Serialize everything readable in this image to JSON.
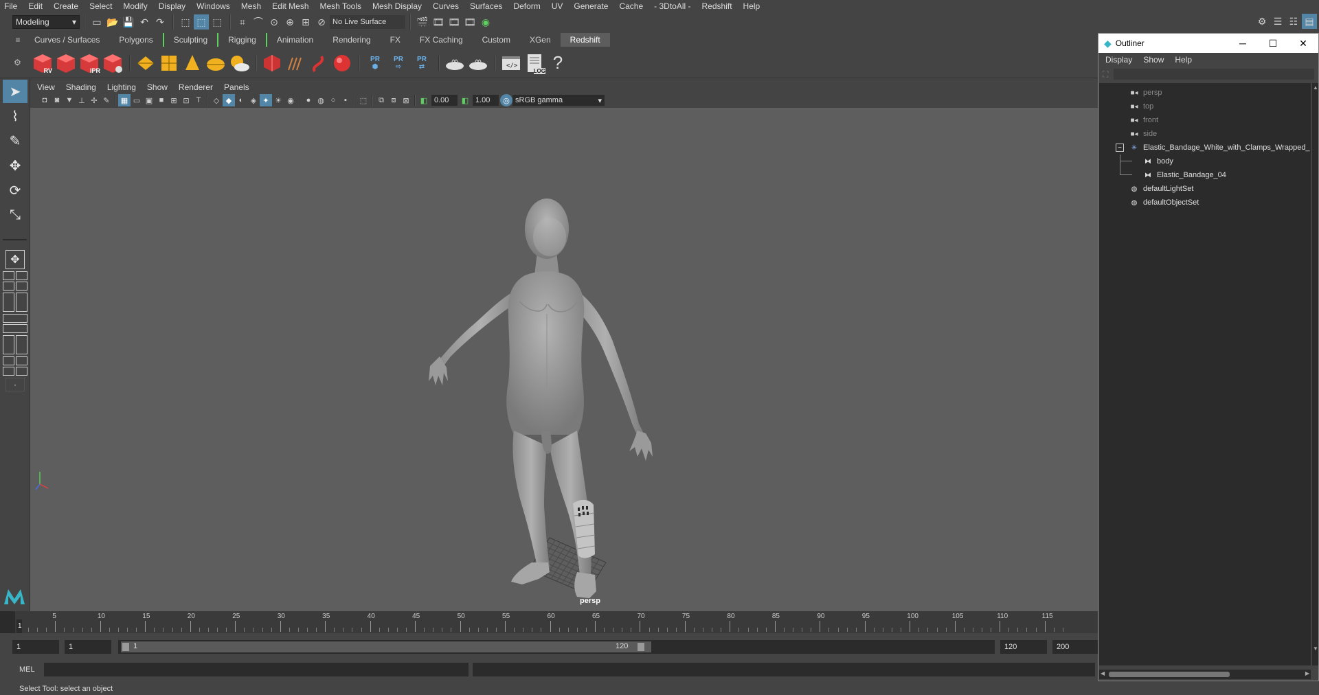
{
  "menubar": {
    "items": [
      "File",
      "Edit",
      "Create",
      "Select",
      "Modify",
      "Display",
      "Windows",
      "Mesh",
      "Edit Mesh",
      "Mesh Tools",
      "Mesh Display",
      "Curves",
      "Surfaces",
      "Deform",
      "UV",
      "Generate",
      "Cache",
      "- 3DtoAll -",
      "Redshift",
      "Help"
    ]
  },
  "statusline": {
    "mode": "Modeling",
    "live_surface": "No Live Surface"
  },
  "shelf": {
    "tabs": [
      "Curves / Surfaces",
      "Polygons",
      "Sculpting",
      "Rigging",
      "Animation",
      "Rendering",
      "FX",
      "FX Caching",
      "Custom",
      "XGen",
      "Redshift"
    ],
    "active_tab": "Redshift",
    "icon_labels": {
      "rv": "RV",
      "ipr": "IPR",
      "pr1": "PR",
      "pr2": "PR",
      "pr3": "PR",
      "log": "LOG",
      "help": "?"
    }
  },
  "panel": {
    "menu": [
      "View",
      "Shading",
      "Lighting",
      "Show",
      "Renderer",
      "Panels"
    ],
    "exposure": "0.00",
    "gamma": "1.00",
    "colorspace": "sRGB gamma",
    "camera": "persp"
  },
  "outliner": {
    "title": "Outliner",
    "menu": [
      "Display",
      "Show",
      "Help"
    ],
    "items": [
      {
        "label": "persp",
        "icon": "camera-icon",
        "dim": true
      },
      {
        "label": "top",
        "icon": "camera-icon",
        "dim": true
      },
      {
        "label": "front",
        "icon": "camera-icon",
        "dim": true
      },
      {
        "label": "side",
        "icon": "camera-icon",
        "dim": true
      },
      {
        "label": "Elastic_Bandage_White_with_Clamps_Wrapped_",
        "icon": "group-icon",
        "dim": false
      },
      {
        "label": "body",
        "icon": "mesh-icon",
        "dim": false
      },
      {
        "label": "Elastic_Bandage_04",
        "icon": "mesh-icon",
        "dim": false
      },
      {
        "label": "defaultLightSet",
        "icon": "set-icon",
        "dim": false
      },
      {
        "label": "defaultObjectSet",
        "icon": "set-icon",
        "dim": false
      }
    ]
  },
  "timeline": {
    "ticks": [
      5,
      10,
      15,
      20,
      25,
      30,
      35,
      40,
      45,
      50,
      55,
      60,
      65,
      70,
      75,
      80,
      85,
      90,
      95,
      100,
      105,
      110,
      115
    ],
    "current_frame": "1"
  },
  "range": {
    "start_field": "1",
    "start_field2": "1",
    "range_start": "1",
    "range_end": "120",
    "end_field": "120",
    "end_field2": "200"
  },
  "cmdline": {
    "label": "MEL"
  },
  "helpline": {
    "text": "Select Tool: select an object"
  },
  "colors": {
    "accent": "#5285a6",
    "viewport_bg": "#5e5e5e",
    "panel_bg": "#444444"
  }
}
